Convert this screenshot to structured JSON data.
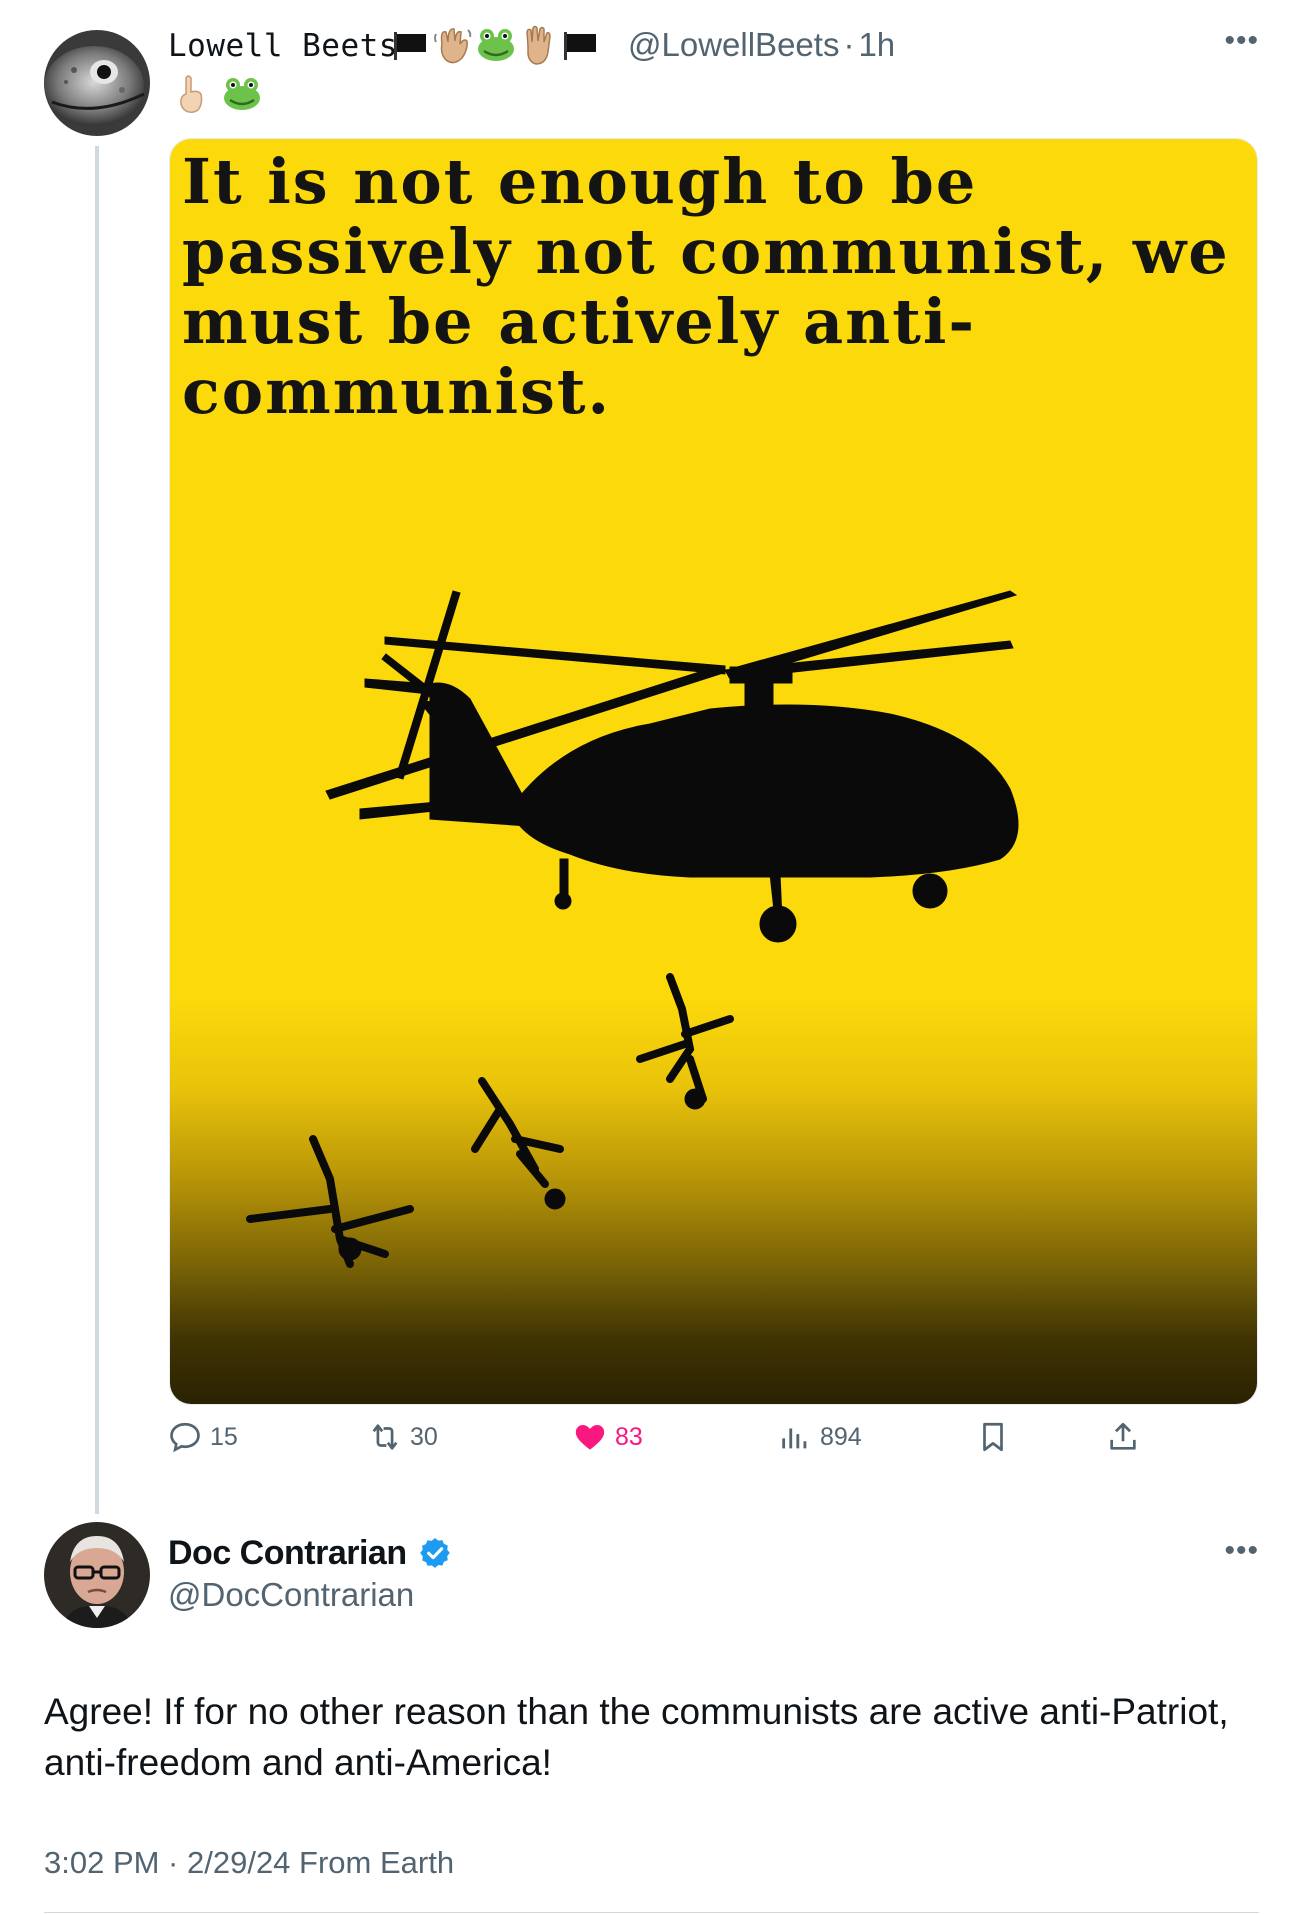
{
  "tweet1": {
    "display_name": "Lowell Beets",
    "handle": "@LowellBeets",
    "time_sep": "·",
    "time": "1h",
    "name_emojis": [
      "black-flag-icon",
      "waving-hand-icon",
      "frog-icon",
      "raised-hand-icon",
      "black-flag-icon"
    ],
    "body_emojis": [
      "pointing-up-icon",
      "frog-icon"
    ],
    "image_text": "It is not enough to be passively not communist, we must be actively anti-communist.",
    "stats": {
      "replies": "15",
      "retweets": "30",
      "likes": "83",
      "views": "894"
    }
  },
  "tweet2": {
    "display_name": "Doc Contrarian",
    "handle": "@DocContrarian",
    "text": "Agree! If for no other reason than the communists are active anti-Patriot, anti-freedom and anti-America!",
    "meta": "3:02 PM · 2/29/24 From Earth"
  },
  "colors": {
    "like": "#f91880",
    "verified": "#1d9bf0",
    "secondary_text": "#536471",
    "media_yellow": "#fbd90b"
  }
}
